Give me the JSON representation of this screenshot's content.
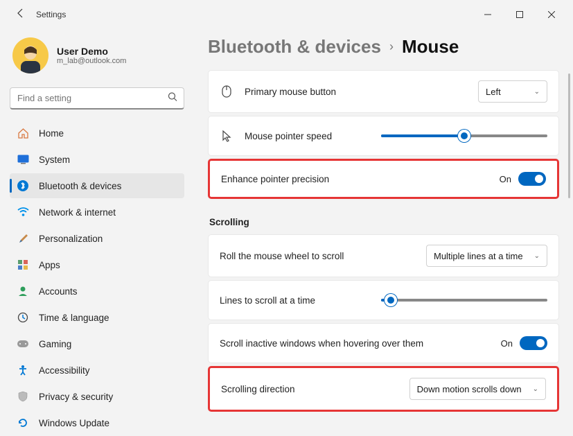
{
  "window": {
    "title": "Settings"
  },
  "user": {
    "name": "User Demo",
    "email": "m_lab@outlook.com"
  },
  "search": {
    "placeholder": "Find a setting"
  },
  "nav": {
    "home": "Home",
    "system": "System",
    "bluetooth": "Bluetooth & devices",
    "network": "Network & internet",
    "personalization": "Personalization",
    "apps": "Apps",
    "accounts": "Accounts",
    "time": "Time & language",
    "gaming": "Gaming",
    "accessibility": "Accessibility",
    "privacy": "Privacy & security",
    "update": "Windows Update"
  },
  "breadcrumb": {
    "parent": "Bluetooth & devices",
    "current": "Mouse"
  },
  "panels": {
    "primary": {
      "label": "Primary mouse button",
      "value": "Left"
    },
    "speed": {
      "label": "Mouse pointer speed",
      "percent": 50
    },
    "enhance": {
      "label": "Enhance pointer precision",
      "state": "On"
    },
    "section_scrolling": "Scrolling",
    "roll": {
      "label": "Roll the mouse wheel to scroll",
      "value": "Multiple lines at a time"
    },
    "lines": {
      "label": "Lines to scroll at a time",
      "percent": 6
    },
    "inactive": {
      "label": "Scroll inactive windows when hovering over them",
      "state": "On"
    },
    "direction": {
      "label": "Scrolling direction",
      "value": "Down motion scrolls down"
    }
  }
}
